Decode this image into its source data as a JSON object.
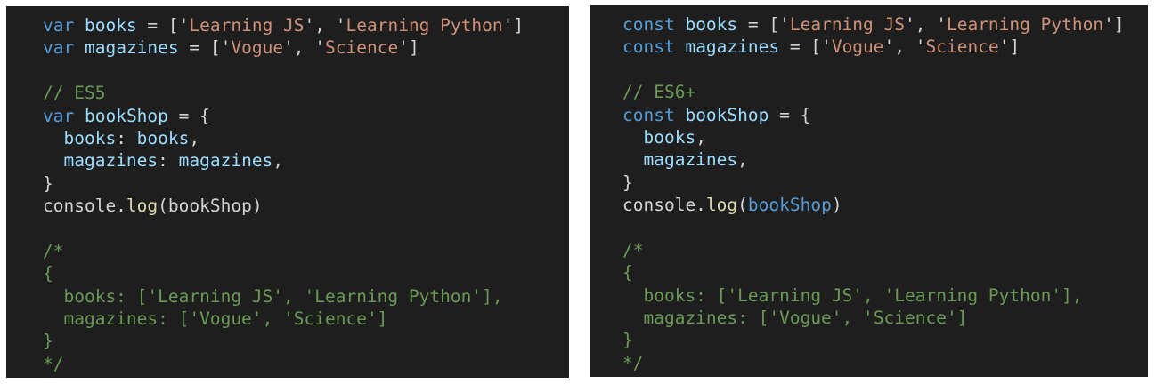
{
  "panels": [
    {
      "id": "es5",
      "lines": [
        [
          [
            "kw",
            "var"
          ],
          [
            "pun",
            " "
          ],
          [
            "var",
            "books"
          ],
          [
            "pun",
            " = ['"
          ],
          [
            "str",
            "Learning JS"
          ],
          [
            "pun",
            "', '"
          ],
          [
            "str",
            "Learning Python"
          ],
          [
            "pun",
            "']"
          ]
        ],
        [
          [
            "kw",
            "var"
          ],
          [
            "pun",
            " "
          ],
          [
            "var",
            "magazines"
          ],
          [
            "pun",
            " = ['"
          ],
          [
            "str",
            "Vogue"
          ],
          [
            "pun",
            "', '"
          ],
          [
            "str",
            "Science"
          ],
          [
            "pun",
            "']"
          ]
        ],
        [],
        [
          [
            "com",
            "// ES5"
          ]
        ],
        [
          [
            "kw",
            "var"
          ],
          [
            "pun",
            " "
          ],
          [
            "var",
            "bookShop"
          ],
          [
            "pun",
            " = {"
          ]
        ],
        [
          [
            "pun",
            "  "
          ],
          [
            "var",
            "books"
          ],
          [
            "pun",
            ": "
          ],
          [
            "var",
            "books"
          ],
          [
            "pun",
            ","
          ]
        ],
        [
          [
            "pun",
            "  "
          ],
          [
            "var",
            "magazines"
          ],
          [
            "pun",
            ": "
          ],
          [
            "var",
            "magazines"
          ],
          [
            "pun",
            ","
          ]
        ],
        [
          [
            "pun",
            "}"
          ]
        ],
        [
          [
            "pun",
            "console."
          ],
          [
            "fn",
            "log"
          ],
          [
            "pun",
            "(bookShop)"
          ]
        ],
        [],
        [
          [
            "com",
            "/*"
          ]
        ],
        [
          [
            "com",
            "{"
          ]
        ],
        [
          [
            "com",
            "  books: ['Learning JS', 'Learning Python'],"
          ]
        ],
        [
          [
            "com",
            "  magazines: ['Vogue', 'Science']"
          ]
        ],
        [
          [
            "com",
            "}"
          ]
        ],
        [
          [
            "com",
            "*/"
          ]
        ]
      ]
    },
    {
      "id": "es6",
      "lines": [
        [
          [
            "kw",
            "const"
          ],
          [
            "pun",
            " "
          ],
          [
            "var",
            "books"
          ],
          [
            "pun",
            " = ['"
          ],
          [
            "str",
            "Learning JS"
          ],
          [
            "pun",
            "', '"
          ],
          [
            "str",
            "Learning Python"
          ],
          [
            "pun",
            "']"
          ]
        ],
        [
          [
            "kw",
            "const"
          ],
          [
            "pun",
            " "
          ],
          [
            "var",
            "magazines"
          ],
          [
            "pun",
            " = ['"
          ],
          [
            "str",
            "Vogue"
          ],
          [
            "pun",
            "', '"
          ],
          [
            "str",
            "Science"
          ],
          [
            "pun",
            "']"
          ]
        ],
        [],
        [
          [
            "com",
            "// ES6+"
          ]
        ],
        [
          [
            "kw",
            "const"
          ],
          [
            "pun",
            " "
          ],
          [
            "var",
            "bookShop"
          ],
          [
            "pun",
            " = {"
          ]
        ],
        [
          [
            "pun",
            "  "
          ],
          [
            "var",
            "books"
          ],
          [
            "pun",
            ","
          ]
        ],
        [
          [
            "pun",
            "  "
          ],
          [
            "var",
            "magazines"
          ],
          [
            "pun",
            ","
          ]
        ],
        [
          [
            "pun",
            "}"
          ]
        ],
        [
          [
            "pun",
            "console."
          ],
          [
            "fn",
            "log"
          ],
          [
            "pun",
            "("
          ],
          [
            "kw",
            "bookShop"
          ],
          [
            "pun",
            ")"
          ]
        ],
        [],
        [
          [
            "com",
            "/*"
          ]
        ],
        [
          [
            "com",
            "{"
          ]
        ],
        [
          [
            "com",
            "  books: ['Learning JS', 'Learning Python'],"
          ]
        ],
        [
          [
            "com",
            "  magazines: ['Vogue', 'Science']"
          ]
        ],
        [
          [
            "com",
            "}"
          ]
        ],
        [
          [
            "com",
            "*/"
          ]
        ]
      ]
    }
  ]
}
